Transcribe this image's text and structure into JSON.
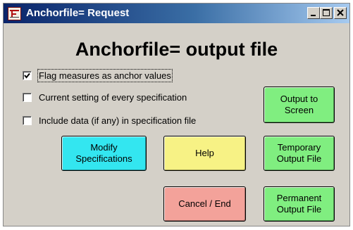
{
  "window": {
    "title": "Anchorfile= Request",
    "app_icon": "facets-app-icon",
    "controls": [
      "minimize-icon",
      "maximize-icon",
      "close-icon"
    ]
  },
  "heading": "Anchorfile= output file",
  "options": [
    {
      "label": "Flag measures as anchor values",
      "checked": true
    },
    {
      "label": "Current setting of every specification",
      "checked": false
    },
    {
      "label": "Include data (if any) in specification file",
      "checked": false
    }
  ],
  "buttons": {
    "output_screen": {
      "line1": "Output to",
      "line2": "Screen",
      "color": "#80ee80"
    },
    "modify": {
      "line1": "Modify",
      "line2": "Specifications",
      "color": "#33e6f0"
    },
    "help": {
      "label": "Help",
      "color": "#f7f285"
    },
    "temporary": {
      "line1": "Temporary",
      "line2": "Output File",
      "color": "#80ee80"
    },
    "cancel": {
      "label": "Cancel / End",
      "color": "#f3a29a"
    },
    "permanent": {
      "line1": "Permanent",
      "line2": "Output File",
      "color": "#80ee80"
    }
  }
}
